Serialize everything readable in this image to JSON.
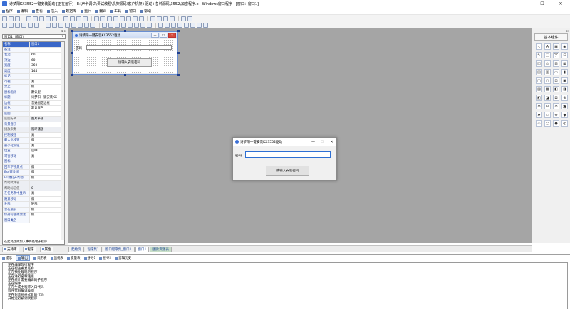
{
  "window": {
    "title": "诗梦阳KX3552一键安装驱动 [正在运行] - E:\\声卡调试\\调试教程\\机架源码\\客户机架+驱动+各种源码\\3552\\加密程序.e - Windows窗口程序 - [窗口：窗口1]",
    "minimize": "—",
    "maximize": "☐",
    "close": "✕"
  },
  "menu": [
    "程序",
    "编辑",
    "查看",
    "插入",
    "数据库",
    "运行",
    "编译",
    "工具",
    "窗口",
    "帮助"
  ],
  "properties": {
    "header_close": "⊟ ✕",
    "selected_object": "窗口1（窗口）",
    "combo_arrow": "▾",
    "rows": [
      {
        "k": "名称",
        "v": "窗口1",
        "sel": true
      },
      {
        "k": "备注",
        "v": ""
      },
      {
        "k": "左边",
        "v": "60"
      },
      {
        "k": "顶边",
        "v": "60"
      },
      {
        "k": "宽度",
        "v": "360"
      },
      {
        "k": "高度",
        "v": "144"
      },
      {
        "k": "标记",
        "v": ""
      },
      {
        "k": "可视",
        "v": "真"
      },
      {
        "k": "禁止",
        "v": "假"
      },
      {
        "k": "鼠标指针",
        "v": "默认型"
      },
      {
        "k": "标题",
        "v": "诗梦阳一键安装KX"
      },
      {
        "k": "边框",
        "v": "普通固定边框"
      },
      {
        "k": "底色",
        "v": "默认底色"
      },
      {
        "k": "底图",
        "v": ""
      },
      {
        "k": "底图方式",
        "v": "图片平铺",
        "grp": true
      },
      {
        "k": "背景音乐",
        "v": ""
      },
      {
        "k": "播放次数",
        "v": "循环播放",
        "grp": true
      },
      {
        "k": "控制按钮",
        "v": "真"
      },
      {
        "k": "最大化按钮",
        "v": "假"
      },
      {
        "k": "最小化按钮",
        "v": "真"
      },
      {
        "k": "位置",
        "v": "居中"
      },
      {
        "k": "可否移动",
        "v": "真"
      },
      {
        "k": "图标",
        "v": ""
      },
      {
        "k": "回车下移焦点",
        "v": "假"
      },
      {
        "k": "Esc键关闭",
        "v": "假"
      },
      {
        "k": "F1键打开帮助",
        "v": "假"
      },
      {
        "k": "帮助文件名",
        "v": "",
        "grp": true
      },
      {
        "k": "帮助标志值",
        "v": "0",
        "grp": true
      },
      {
        "k": "在任务条中显示",
        "v": "真"
      },
      {
        "k": "随意移动",
        "v": "假"
      },
      {
        "k": "外形",
        "v": "矩形"
      },
      {
        "k": "总在最前",
        "v": "假"
      },
      {
        "k": "保持标题条激活",
        "v": "假"
      },
      {
        "k": "窗口类名",
        "v": ""
      }
    ],
    "event_combo": "在此处选择加入事件处理子程序"
  },
  "left_tabs": [
    "支持库",
    "程序",
    "属性"
  ],
  "doc_tabs": [
    "起始页",
    "程序集1",
    "窗口程序集_窗口1",
    "窗口1",
    "图片资源表"
  ],
  "toolbox": {
    "header_close": "✕",
    "title": "基本组件",
    "items": [
      "↖",
      "A",
      "▣",
      "◉",
      "✎",
      "▢",
      "字",
      "⊟",
      "☑",
      "◎",
      "⊞",
      "▦",
      "▤",
      "▥",
      "▭",
      "▮",
      "◫",
      "▯",
      "⊡",
      "▣",
      "▨",
      "▩",
      "◧",
      "◨",
      "◩",
      "◪",
      "⊠",
      "⊕",
      "⊗",
      "⊖",
      "⊘",
      "◙",
      "▰",
      "▱",
      "◈",
      "◆",
      "◇",
      "○",
      "●",
      "◐"
    ]
  },
  "bottom_tabs": [
    "提示",
    "输出",
    "调用表",
    "监视表",
    "变量表",
    "搜寻1",
    "搜寻2",
    "剪辑历史"
  ],
  "output_lines": [
    "正在编译现行程序",
    "正在检查重复名称",
    "正在预处理现行程序",
    "正在进行名称连接",
    "正在统计需要编译的子程序",
    "正在编译",
    "正在生成主程序入口代码",
    "程序代码编译成功",
    "正在封装易格式目的代码",
    "开始运行被调试程序"
  ],
  "design_form": {
    "title": "诗梦阳一键安装KX3552驱动",
    "min": "—",
    "max": "☐",
    "close": "✕",
    "label": "密码",
    "button": "请输入安装密码"
  },
  "run_window": {
    "title": "诗梦阳一键安装KX3552驱动",
    "min": "—",
    "max": "☐",
    "close": "✕",
    "label": "密码",
    "button": "请输入安装密码"
  }
}
